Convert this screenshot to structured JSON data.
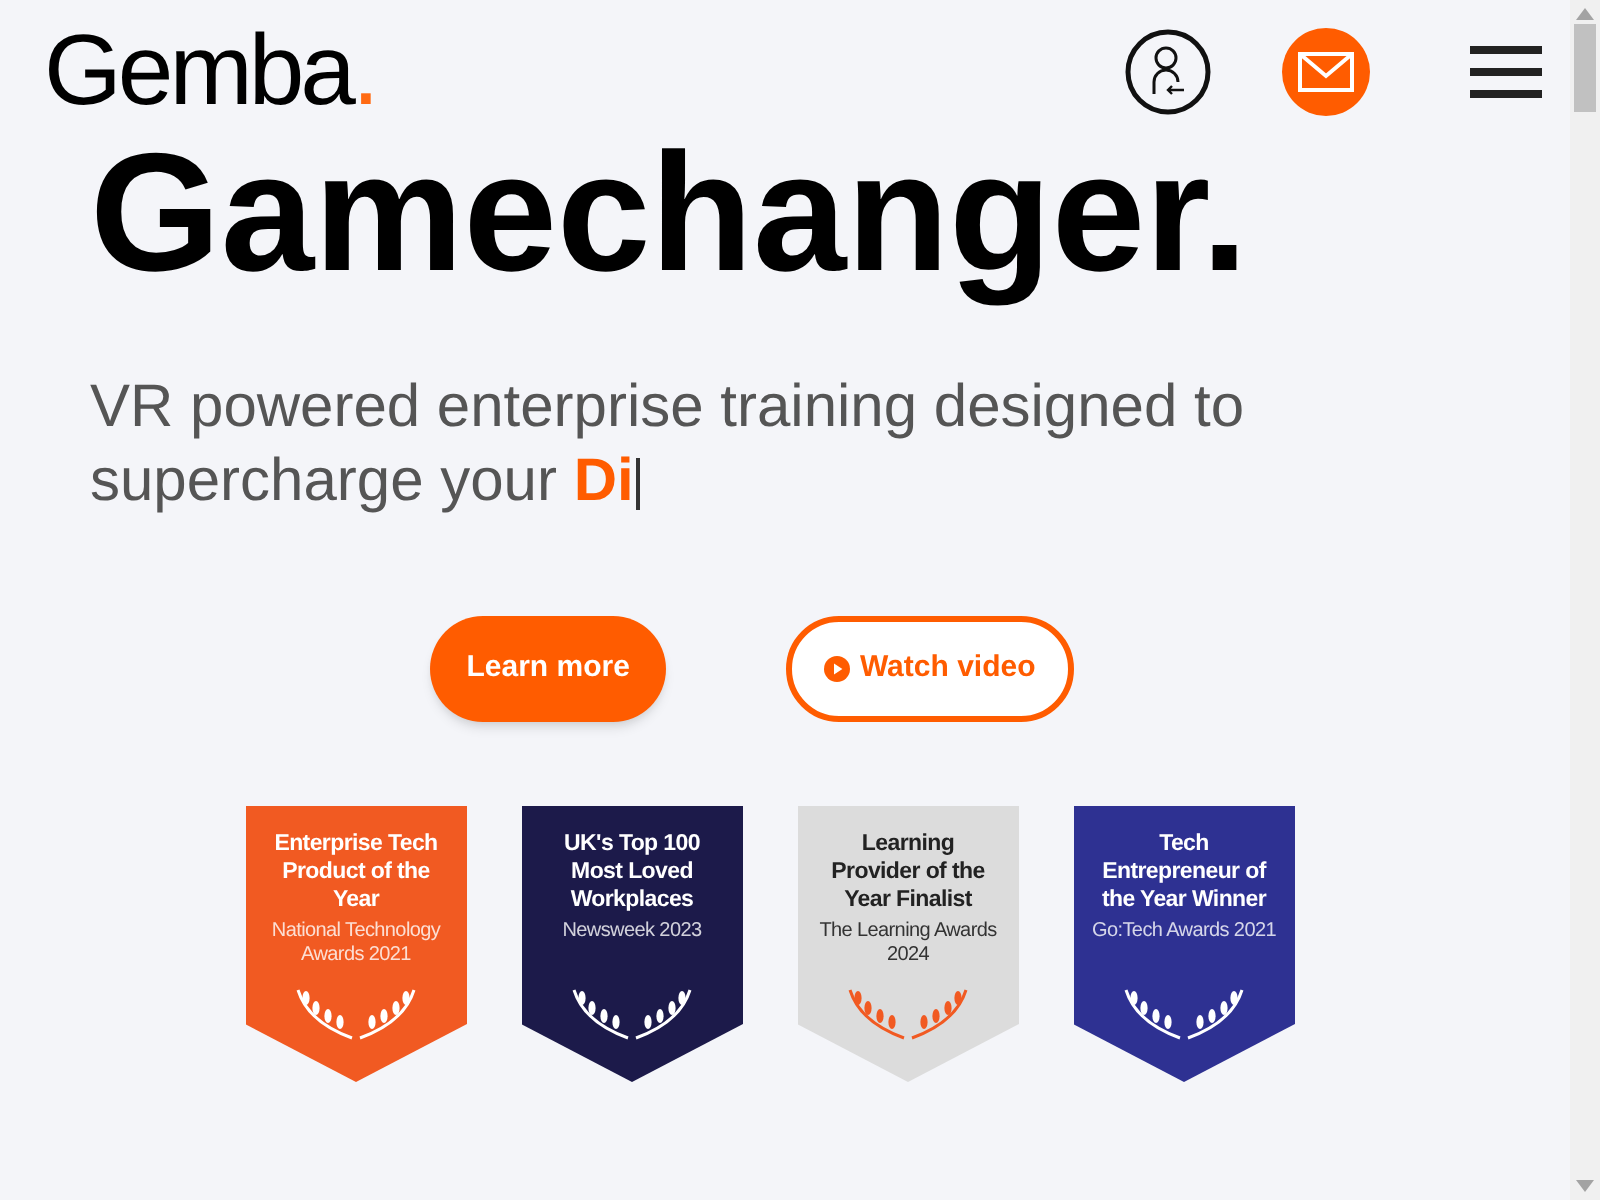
{
  "header": {
    "logo": {
      "text": "Gemba",
      "dot": "."
    }
  },
  "hero": {
    "headline": "Gamechanger.",
    "tagline": "VR powered enterprise training designed to supercharge your",
    "typed": "Di"
  },
  "buttons": [
    {
      "label": "Learn more",
      "kind": "filled"
    },
    {
      "label": "Watch video",
      "kind": "outline"
    }
  ],
  "awards": [
    {
      "title": "Enterprise Tech Product of the Year",
      "source": "National Technology Awards 2021",
      "color": "#f15a22"
    },
    {
      "title": "UK's Top 100 Most Loved Workplaces",
      "source": "Newsweek 2023",
      "color": "#1c1a4a"
    },
    {
      "title": "Learning Provider of the Year Finalist",
      "source": "The Learning Awards 2024",
      "color": "#dcdcdc"
    },
    {
      "title": "Tech Entrepreneur of the Year Winner",
      "source": "Go:Tech Awards 2021",
      "color": "#2e3192"
    }
  ]
}
